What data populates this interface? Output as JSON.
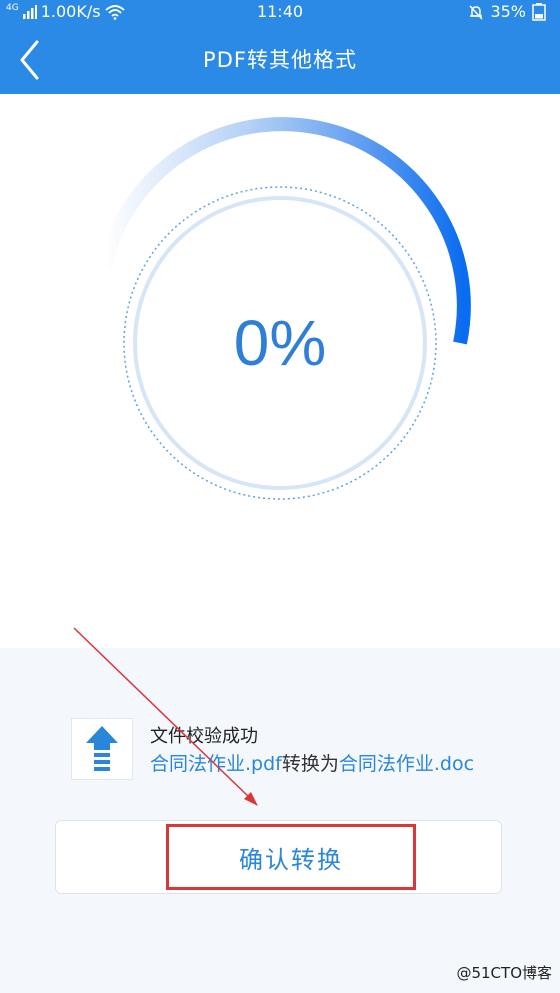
{
  "status_bar": {
    "network": "4G",
    "speed": "1.00K/s",
    "time": "11:40",
    "battery": "35%",
    "icons": [
      "signal-icon",
      "wifi-icon",
      "bell-off-icon",
      "battery-icon"
    ]
  },
  "header": {
    "title": "PDF转其他格式",
    "back_icon": "chevron-left-icon"
  },
  "progress": {
    "percent_text": "0%",
    "ring_fraction": 0.25
  },
  "file_status": {
    "icon": "upload-arrow-icon",
    "title": "文件校验成功",
    "source_file": "合同法作业.pdf",
    "connector": "转换为",
    "target_file": "合同法作业.doc"
  },
  "actions": {
    "confirm_label": "确认转换"
  },
  "watermark": "@51CTO博客",
  "colors": {
    "primary": "#2a8ae6",
    "progress_text": "#2f7fd8",
    "link": "#2a86d9",
    "highlight": "#d9383a"
  }
}
